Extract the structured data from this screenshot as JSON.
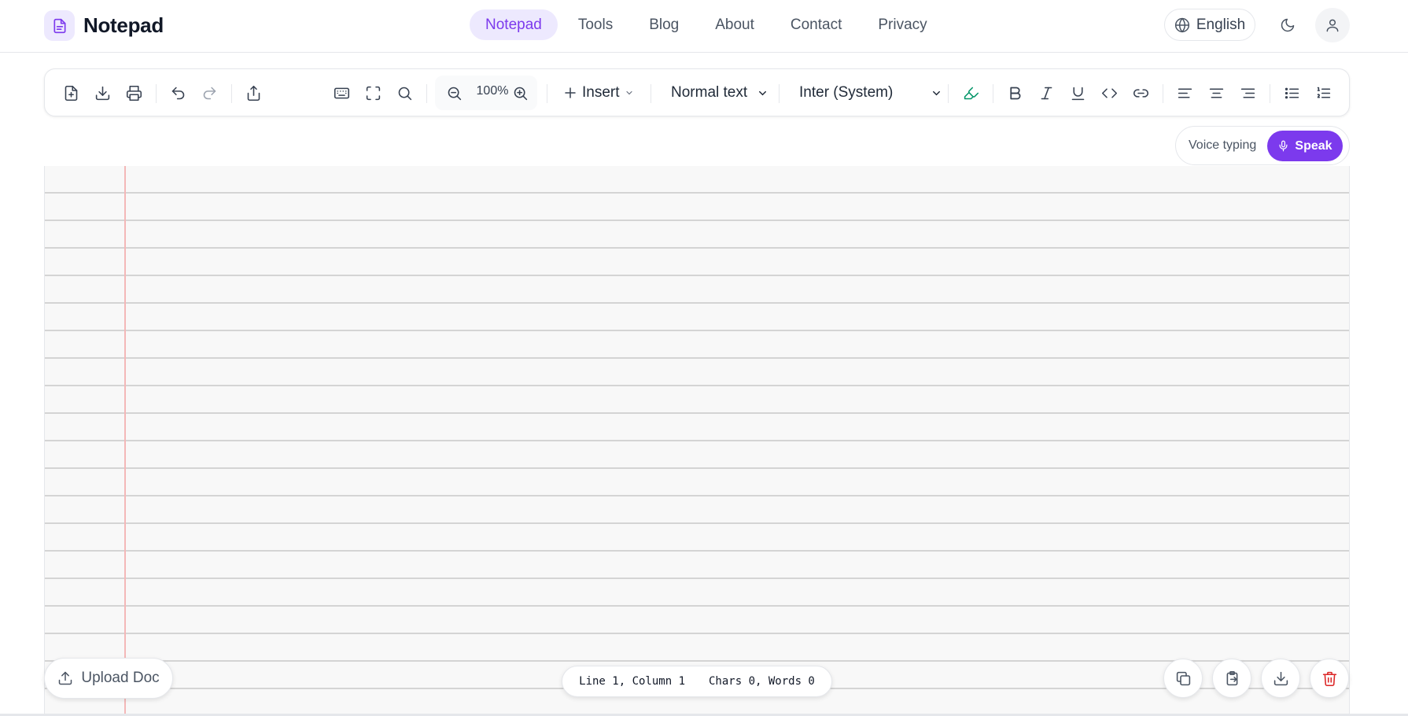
{
  "header": {
    "app_name": "Notepad",
    "logo_icon": "document-icon",
    "nav": [
      {
        "label": "Notepad",
        "active": true
      },
      {
        "label": "Tools",
        "active": false
      },
      {
        "label": "Blog",
        "active": false
      },
      {
        "label": "About",
        "active": false
      },
      {
        "label": "Contact",
        "active": false
      },
      {
        "label": "Privacy",
        "active": false
      }
    ],
    "language": "English",
    "theme_icon": "moon-icon",
    "user_icon": "user-icon"
  },
  "toolbar": {
    "file_icons": [
      "new-document-icon",
      "download-icon",
      "print-icon"
    ],
    "history_icons": [
      "undo-icon",
      "redo-icon"
    ],
    "share_icon": "share-icon",
    "view_icons": [
      "keyboard-icon",
      "fullscreen-icon",
      "search-icon"
    ],
    "zoom": "100%",
    "insert_label": "Insert",
    "text_style": "Normal text",
    "font": "Inter (System)",
    "format_icons": [
      "highlighter-icon",
      "bold-icon",
      "italic-icon",
      "underline-icon",
      "code-icon",
      "link-icon"
    ],
    "align_icons": [
      "align-left-icon",
      "align-center-icon",
      "align-right-icon"
    ],
    "list_icons": [
      "bullet-list-icon",
      "numbered-list-icon"
    ]
  },
  "voice": {
    "label": "Voice typing",
    "button": "Speak"
  },
  "editor": {
    "content": "",
    "upload_label": "Upload Doc",
    "position": "Line 1, Column 1",
    "counts": "Chars 0, Words 0"
  },
  "actions": [
    "copy-icon",
    "paste-icon",
    "download-icon",
    "trash-icon"
  ],
  "colors": {
    "accent": "#7c3aed",
    "accent_soft": "#ede9fe",
    "highlighter": "#059669",
    "danger": "#dc2626",
    "margin_line": "#f4b8b8"
  }
}
